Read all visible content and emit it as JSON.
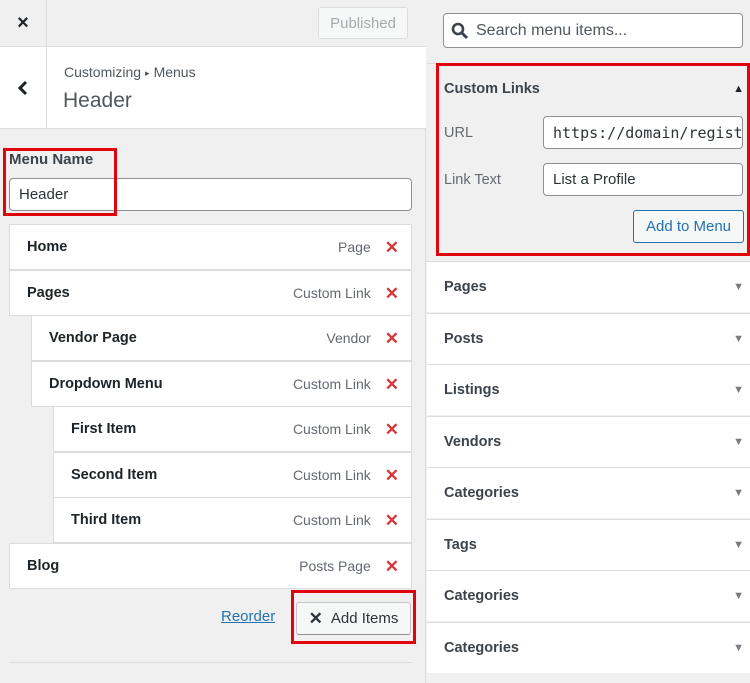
{
  "topbar": {
    "close_icon": "×",
    "published_label": "Published"
  },
  "header": {
    "breadcrumb_parent": "Customizing",
    "breadcrumb_sep": "▸",
    "breadcrumb_current": "Menus",
    "title": "Header"
  },
  "menu_name": {
    "label": "Menu Name",
    "value": "Header"
  },
  "menu_items": [
    {
      "name": "Home",
      "type": "Page",
      "depth": 0
    },
    {
      "name": "Pages",
      "type": "Custom Link",
      "depth": 0
    },
    {
      "name": "Vendor Page",
      "type": "Vendor",
      "depth": 1
    },
    {
      "name": "Dropdown Menu",
      "type": "Custom Link",
      "depth": 1
    },
    {
      "name": "First Item",
      "type": "Custom Link",
      "depth": 2
    },
    {
      "name": "Second Item",
      "type": "Custom Link",
      "depth": 2
    },
    {
      "name": "Third Item",
      "type": "Custom Link",
      "depth": 2
    },
    {
      "name": "Blog",
      "type": "Posts Page",
      "depth": 0
    }
  ],
  "delete_icon": "✕",
  "actions": {
    "reorder_label": "Reorder",
    "add_items_label": "Add Items",
    "add_items_icon": "✕"
  },
  "search": {
    "placeholder": "Search menu items..."
  },
  "custom_links": {
    "title": "Custom Links",
    "expanded_icon": "▲",
    "url_label": "URL",
    "url_value": "https://domain/register",
    "link_text_label": "Link Text",
    "link_text_value": "List a Profile",
    "add_button": "Add to Menu"
  },
  "sections": [
    {
      "label": "Pages"
    },
    {
      "label": "Posts"
    },
    {
      "label": "Listings"
    },
    {
      "label": "Vendors"
    },
    {
      "label": "Categories"
    },
    {
      "label": "Tags"
    },
    {
      "label": "Categories"
    },
    {
      "label": "Categories"
    }
  ],
  "collapsed_icon": "▼",
  "highlight_color": "#e0050d"
}
